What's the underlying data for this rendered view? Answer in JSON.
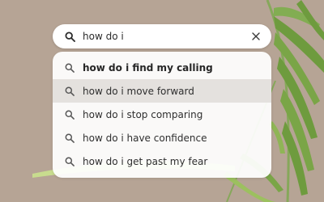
{
  "search": {
    "query": "how do i",
    "icon": "search-icon",
    "clear_icon": "close-icon"
  },
  "suggestions": [
    {
      "label": "how do i find my calling",
      "icon": "search-icon"
    },
    {
      "label": "how do i move forward",
      "icon": "search-icon",
      "highlighted": true
    },
    {
      "label": "how do i stop comparing",
      "icon": "search-icon"
    },
    {
      "label": "how do i have confidence",
      "icon": "search-icon"
    },
    {
      "label": "how do i get past my fear",
      "icon": "search-icon"
    }
  ],
  "colors": {
    "background": "#b6a495",
    "leaf": "#6e9b3e",
    "highlight": "#e4e1de"
  }
}
